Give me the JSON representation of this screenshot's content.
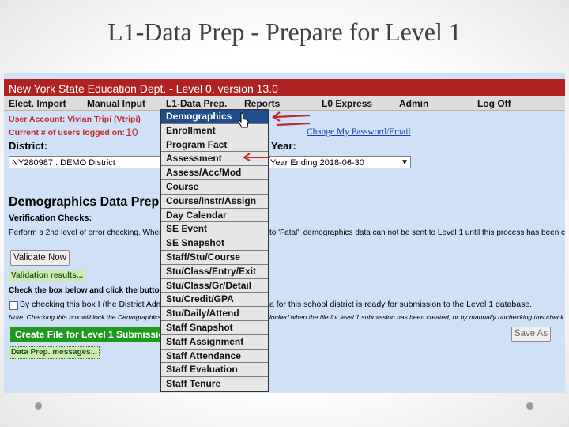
{
  "slide": {
    "title": "L1-Data Prep - Prepare for Level 1"
  },
  "app": {
    "banner": "New York State Education Dept. - Level 0, version 13.0"
  },
  "menu": [
    "Elect. Import",
    "Manual Input",
    "L1-Data Prep.",
    "Reports",
    "L0 Express",
    "Admin",
    "Log Off"
  ],
  "user": {
    "account": "User Account: Vivian Tripi (Vtripi)",
    "logged_label": "Current # of users logged on:",
    "logged_count": "10",
    "change_password": "Change My Password/Email"
  },
  "district": {
    "label": "District:",
    "value": "NY280987 : DEMO District"
  },
  "year": {
    "label": "Year:",
    "value": "Year Ending 2018-06-30"
  },
  "page": {
    "heading": "Demographics Data Prep. fo",
    "verification_label": "Verification Checks:",
    "verify_text_left": "Perform a 2nd level of error checking. When T",
    "verify_text_right": "to 'Fatal', demographics data can not be sent to Level 1 until this process has been completed.",
    "validate_button": "Validate Now",
    "validation_results": "Validation results...",
    "check_box_text": "Check the box below and click the button to",
    "certify_left": "By checking this box I (the District Admi",
    "certify_right": "a for this school district is ready for submission to the Level 1 database.",
    "note_left": "Note: Checking this box will lock the Demographics d",
    "note_right": "locked when the file for level 1 submission has been created, or by manually unchecking this check box.",
    "create_file": "Create File for Level 1 Submissio",
    "data_prep_messages": "Data Prep. messages...",
    "save_as": "Save As"
  },
  "dropdown_items": [
    "Demographics",
    "Enrollment",
    "Program Fact",
    "Assessment",
    "Assess/Acc/Mod",
    "Course",
    "Course/Instr/Assign",
    "Day Calendar",
    "SE Event",
    "SE Snapshot",
    "Staff/Stu/Course",
    "Stu/Class/Entry/Exit",
    "Stu/Class/Gr/Detail",
    "Stu/Credit/GPA",
    "Stu/Daily/Attend",
    "Staff Snapshot",
    "Staff Assignment",
    "Staff Attendance",
    "Staff Evaluation",
    "Staff Tenure"
  ],
  "selected_item": "Demographics",
  "colors": {
    "banner": "#b02222",
    "page_bg": "#cfe0f7",
    "selected": "#1f4d8c",
    "green": "#1f9a1f",
    "annotation_arrow": "#c62828"
  }
}
